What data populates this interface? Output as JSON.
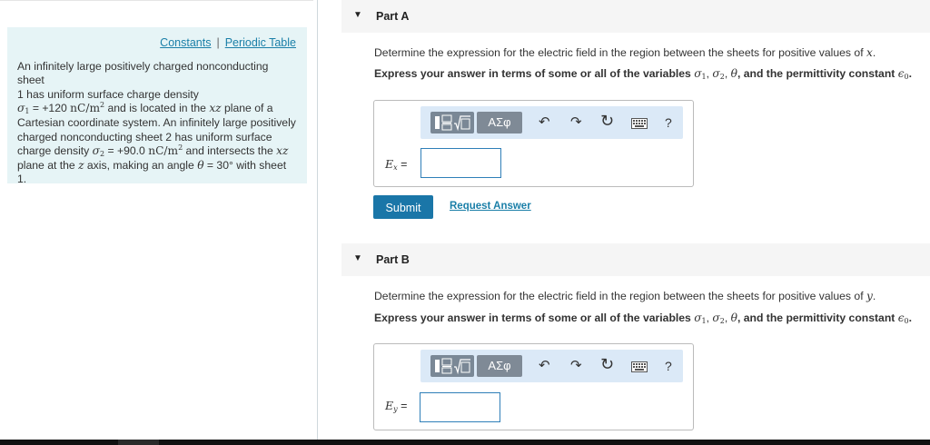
{
  "info": {
    "links": {
      "constants": "Constants",
      "separator": "|",
      "periodic_table": "Periodic Table"
    },
    "problem": {
      "l1": "An infinitely large positively charged nonconducting sheet",
      "l2": "1 has uniform surface charge density",
      "sigma1_sym": "σ",
      "sigma1_sub": "1",
      "sigma1_value": "= +120",
      "unit_nC": "nC/m",
      "unit_exp": "2",
      "l3_tail": "and is located in the",
      "xz": "xz",
      "l3_end": "plane of a",
      "l4": "Cartesian coordinate system. An infinitely large positively",
      "l5": "charged nonconducting sheet 2 has uniform surface",
      "l6_head": "charge density",
      "sigma2_sym": "σ",
      "sigma2_sub": "2",
      "sigma2_value": "= +90.0",
      "l6_tail": "and intersects the",
      "l7_head": "plane at the",
      "z": "z",
      "l7_mid": "axis, making an angle",
      "theta": "θ",
      "theta_value": "= 30° with sheet",
      "l8": "1."
    }
  },
  "partA": {
    "arrow": "▼",
    "title": "Part A",
    "question_head": "Determine the expression for the electric field in the region between the sheets for positive values of",
    "question_var": "x",
    "question_end": ".",
    "instruction_head": "Express your answer in terms of some or all of the variables",
    "instruction_vars": "σ",
    "instruction_sub1": "1",
    "instruction_comma": ",",
    "instruction_sub2": "2",
    "instruction_theta": "θ",
    "instruction_tail": ", and the permittivity constant",
    "instruction_eps": "ϵ",
    "instruction_eps_sub": "0",
    "label_E": "E",
    "label_sub": "x",
    "label_eq": "=",
    "answer_value": ""
  },
  "partB": {
    "arrow": "▼",
    "title": "Part B",
    "question_head": "Determine the expression for the electric field in the region between the sheets for positive values of",
    "question_var": "y",
    "question_end": ".",
    "instruction_head": "Express your answer in terms of some or all of the variables",
    "instruction_vars": "σ",
    "instruction_sub1": "1",
    "instruction_comma": ",",
    "instruction_sub2": "2",
    "instruction_theta": "θ",
    "instruction_tail": ", and the permittivity constant",
    "instruction_eps": "ϵ",
    "instruction_eps_sub": "0",
    "label_E": "E",
    "label_sub": "y",
    "label_eq": "=",
    "answer_value": ""
  },
  "toolbar": {
    "templates_icon": "templates-icon",
    "symbols_label": "ΑΣφ",
    "undo_icon": "↶",
    "redo_icon": "↷",
    "reset_icon": "↻",
    "keyboard_icon": "keyboard-icon",
    "help_label": "?"
  },
  "actions": {
    "submit": "Submit",
    "request_answer": "Request Answer"
  },
  "colors": {
    "panel_bg": "#e6f4f6",
    "link": "#1a7fa8",
    "submit_bg": "#1a76a8",
    "toolbar_bg": "#dbe9f7",
    "input_border": "#2f7fb8"
  }
}
